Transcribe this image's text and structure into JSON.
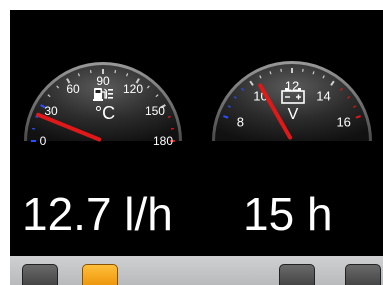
{
  "gauges": {
    "temperature": {
      "scale": [
        0,
        30,
        60,
        90,
        120,
        150,
        180
      ],
      "unit": "°C",
      "icon": "fuel-pump-icon",
      "value": 22
    },
    "voltage": {
      "scale": [
        8,
        10,
        12,
        14,
        16
      ],
      "unit": "V",
      "icon": "battery-icon",
      "value": 10.3
    }
  },
  "readouts": {
    "fuel_rate": "12.7 l/h",
    "engine_hours": "15 h"
  },
  "buttons": [
    {
      "id": "button-1",
      "active": false
    },
    {
      "id": "button-2",
      "active": true
    },
    {
      "id": "button-3",
      "active": false
    },
    {
      "id": "button-4",
      "active": false
    }
  ],
  "colors": {
    "needle": "#e01818",
    "active_button": "#ffa000",
    "text": "#ffffff"
  }
}
